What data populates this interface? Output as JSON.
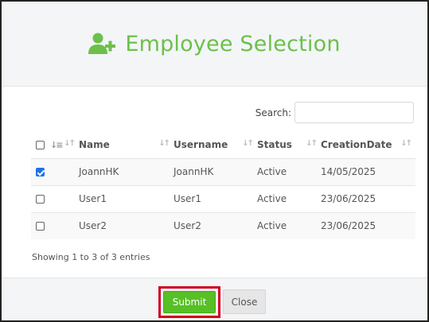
{
  "header": {
    "title": "Employee Selection",
    "icon": "add-user-icon",
    "accent_color": "#6cc04a"
  },
  "search": {
    "label": "Search:",
    "value": "",
    "placeholder": ""
  },
  "table": {
    "columns": [
      "Name",
      "Username",
      "Status",
      "CreationDate"
    ],
    "select_all_checked": false,
    "rows": [
      {
        "checked": true,
        "name": "JoannHK",
        "username": "JoannHK",
        "status": "Active",
        "creation_date": "14/05/2025"
      },
      {
        "checked": false,
        "name": "User1",
        "username": "User1",
        "status": "Active",
        "creation_date": "23/06/2025"
      },
      {
        "checked": false,
        "name": "User2",
        "username": "User2",
        "status": "Active",
        "creation_date": "23/06/2025"
      }
    ]
  },
  "info": "Showing 1 to 3 of 3 entries",
  "footer": {
    "submit_label": "Submit",
    "close_label": "Close",
    "submit_color": "#56c026",
    "highlight_color": "#d0021b"
  }
}
